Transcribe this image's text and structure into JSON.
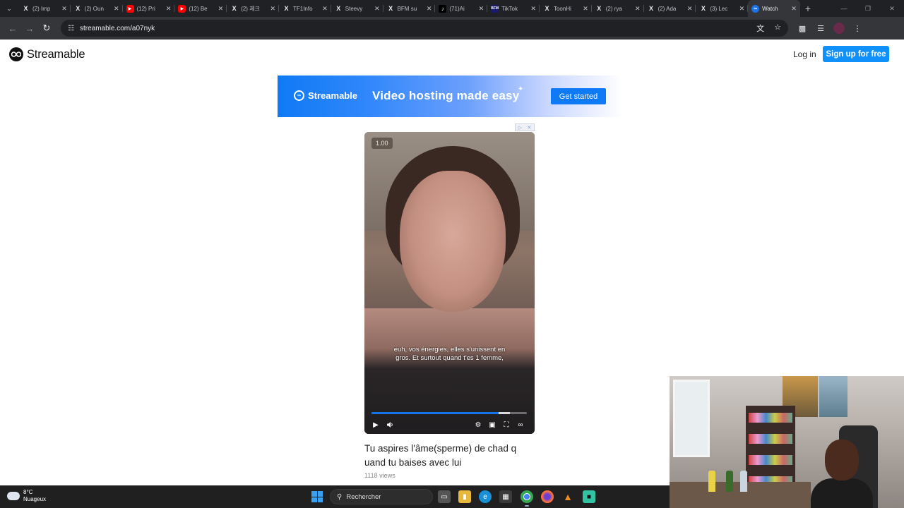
{
  "browser": {
    "tabs": [
      {
        "label": "(2) Imp",
        "icon": "x-icon"
      },
      {
        "label": "(2) Oun",
        "icon": "x-icon"
      },
      {
        "label": "(12) Pri",
        "icon": "youtube-icon"
      },
      {
        "label": "(12) Be",
        "icon": "youtube-icon"
      },
      {
        "label": "(2) 제크",
        "icon": "x-icon"
      },
      {
        "label": "TF1Info",
        "icon": "x-icon"
      },
      {
        "label": "Steevy",
        "icon": "x-icon"
      },
      {
        "label": "BFM su",
        "icon": "x-icon"
      },
      {
        "label": "(71)Ai",
        "icon": "tiktok-icon"
      },
      {
        "label": "TikTok",
        "icon": "bfm-icon"
      },
      {
        "label": "ToonHi",
        "icon": "x-icon"
      },
      {
        "label": "(2) rya",
        "icon": "x-icon"
      },
      {
        "label": "(2) Ada",
        "icon": "x-icon"
      },
      {
        "label": "(3) Lec",
        "icon": "x-icon"
      },
      {
        "label": "Watch",
        "icon": "streamable-icon",
        "active": true
      }
    ],
    "url": "streamable.com/a07nyk"
  },
  "site": {
    "logo_text": "Streamable",
    "login_label": "Log in",
    "signup_label": "Sign up for free"
  },
  "ad": {
    "logo_text": "Streamable",
    "tagline": "Video hosting made easy",
    "cta_label": "Get started"
  },
  "video": {
    "timestamp": "1.00",
    "subtitle": "euh, vos énergies, elles s'unissent en gros. Et surtout quand t'es 1 femme,",
    "progress": 0.82,
    "buffered": 0.89,
    "title": "Tu aspires l'âme(sperme) de chad q uand tu baises avec lui",
    "views": "1118 views"
  },
  "taskbar": {
    "weather_temp": "8°C",
    "weather_desc": "Nuageux",
    "search_label": "Rechercher"
  },
  "colors": {
    "accent": "#0f90fa",
    "chrome_dark": "#202124",
    "chrome_toolbar": "#35363a",
    "seek_played": "#1773ea"
  }
}
